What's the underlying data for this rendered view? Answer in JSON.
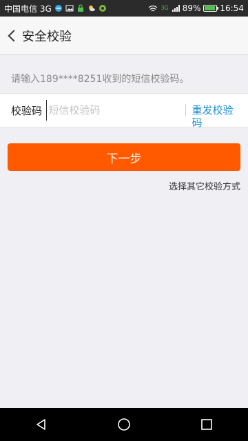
{
  "status": {
    "carrier": "中国电信 3G",
    "battery": "89%",
    "time": "16:54",
    "battery_level": 0.89,
    "network_badge": "3G"
  },
  "header": {
    "title": "安全校验",
    "back_icon": "chevron-left-icon"
  },
  "hint": "请输入189****8251收到的短信校验码。",
  "code": {
    "label": "校验码",
    "placeholder": "短信校验码",
    "value": "",
    "resend_label": "重发校验码"
  },
  "next_button_label": "下一步",
  "other_method_label": "选择其它校验方式",
  "colors": {
    "accent": "#ff5a00",
    "link": "#1a8fd6"
  },
  "nav": {
    "back_icon": "triangle-back-icon",
    "home_icon": "circle-home-icon",
    "recents_icon": "square-recents-icon"
  }
}
